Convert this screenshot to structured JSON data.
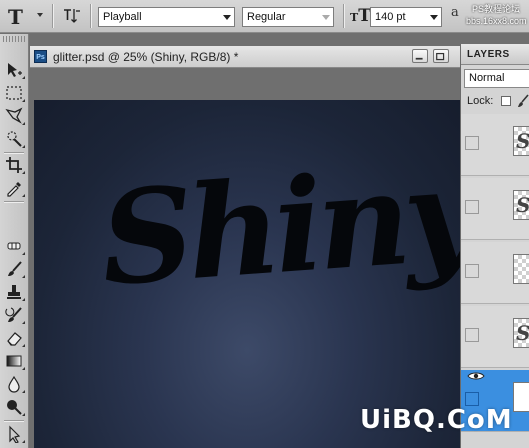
{
  "options_bar": {
    "tool_glyph": "T",
    "orientation_icon": "text-orientation-icon",
    "font_family": "Playball",
    "font_style": "Regular",
    "size_glyph": "T",
    "font_size": "140 pt",
    "antialias_glyph": "a",
    "watermark_top": "PS教程论坛",
    "watermark_url": "bbs.16xx8.com"
  },
  "document": {
    "tab_icon": "Ps",
    "title": "glitter.psd @ 25% (Shiny, RGB/8) *",
    "canvas_text": "Shiny",
    "canvas_colors": {
      "center": "#3d4a68",
      "edge": "#161d2d",
      "text": "#05070b"
    }
  },
  "layers_panel": {
    "tab_label": "LAYERS",
    "blend_mode": "Normal",
    "lock_label": "Lock:",
    "layers": [
      {
        "thumb": "S",
        "selected": false
      },
      {
        "thumb": "S",
        "selected": false
      },
      {
        "thumb": "",
        "selected": false
      },
      {
        "thumb": "S",
        "selected": false
      },
      {
        "thumb": "",
        "selected": true
      }
    ],
    "selection_color": "#3b8fe0"
  },
  "tools": [
    "move-tool",
    "marquee-tool",
    "lasso-tool",
    "quick-selection-tool",
    "crop-tool",
    "eyedropper-tool",
    "healing-brush-tool",
    "brush-tool",
    "clone-stamp-tool",
    "history-brush-tool",
    "eraser-tool",
    "gradient-tool",
    "blur-tool",
    "dodge-tool",
    "path-selection-tool",
    "type-tool"
  ],
  "footer_watermark": "UiBQ.CoM"
}
